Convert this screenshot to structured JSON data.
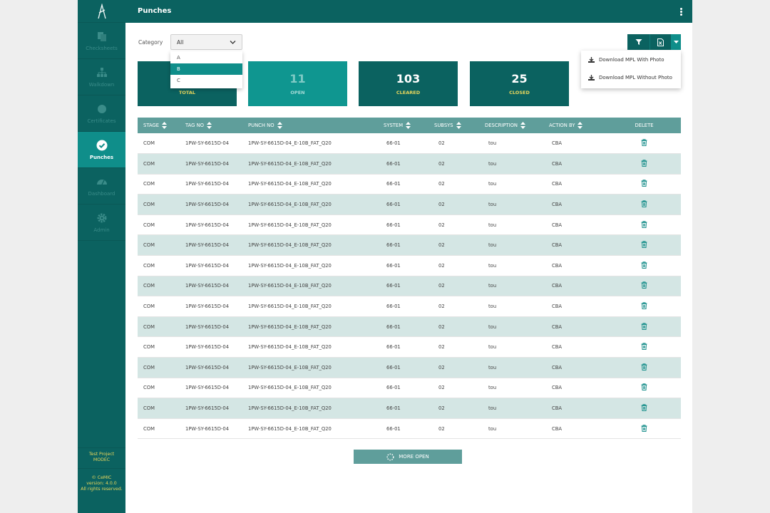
{
  "sidebar": {
    "items": [
      {
        "label": "Checksheets",
        "icon": "checksheets-icon"
      },
      {
        "label": "Walkdown",
        "icon": "hierarchy-icon"
      },
      {
        "label": "Certificates",
        "icon": "certificate-icon"
      },
      {
        "label": "Punches",
        "icon": "check-circle-icon",
        "active": true
      },
      {
        "label": "Dashboard",
        "icon": "gauge-icon"
      },
      {
        "label": "Admin",
        "icon": "gear-icon"
      }
    ],
    "project_line1": "Test Project",
    "project_line2": "MODEC",
    "footer_line1": "© CeMIC",
    "footer_line2": "version: 4.0.0",
    "footer_line3": "All rights reserved."
  },
  "header": {
    "title": "Punches"
  },
  "filter": {
    "label": "Category",
    "selected": "All",
    "options": [
      "A",
      "B",
      "C"
    ],
    "highlighted": "B"
  },
  "cards": [
    {
      "value": "",
      "label": "TOTAL"
    },
    {
      "value": "11",
      "label": "OPEN"
    },
    {
      "value": "103",
      "label": "CLEARED"
    },
    {
      "value": "25",
      "label": "CLOSED"
    }
  ],
  "export_menu": {
    "with_photo": "Download MPL With Photo",
    "without_photo": "Download MPL Without Photo"
  },
  "table": {
    "headers": {
      "stage": "STAGE",
      "tag_no": "TAG NO",
      "punch_no": "PUNCH NO",
      "system": "SYSTEM",
      "subsys": "SUBSYS",
      "description": "DESCRIPTION",
      "action_by": "ACTION BY",
      "delete": "DELETE"
    },
    "rows": [
      {
        "stage": "COM",
        "tag_no": "1PW-SY-6615D-04",
        "punch_no": "1PW-SY-6615D-04_E-10B_FAT_Q20",
        "system": "66-01",
        "subsys": "02",
        "description": "tou",
        "action_by": "CBA"
      },
      {
        "stage": "COM",
        "tag_no": "1PW-SY-6615D-04",
        "punch_no": "1PW-SY-6615D-04_E-10B_FAT_Q20",
        "system": "66-01",
        "subsys": "02",
        "description": "tou",
        "action_by": "CBA"
      },
      {
        "stage": "COM",
        "tag_no": "1PW-SY-6615D-04",
        "punch_no": "1PW-SY-6615D-04_E-10B_FAT_Q20",
        "system": "66-01",
        "subsys": "02",
        "description": "tou",
        "action_by": "CBA"
      },
      {
        "stage": "COM",
        "tag_no": "1PW-SY-6615D-04",
        "punch_no": "1PW-SY-6615D-04_E-10B_FAT_Q20",
        "system": "66-01",
        "subsys": "02",
        "description": "tou",
        "action_by": "CBA"
      },
      {
        "stage": "COM",
        "tag_no": "1PW-SY-6615D-04",
        "punch_no": "1PW-SY-6615D-04_E-10B_FAT_Q20",
        "system": "66-01",
        "subsys": "02",
        "description": "tou",
        "action_by": "CBA"
      },
      {
        "stage": "COM",
        "tag_no": "1PW-SY-6615D-04",
        "punch_no": "1PW-SY-6615D-04_E-10B_FAT_Q20",
        "system": "66-01",
        "subsys": "02",
        "description": "tou",
        "action_by": "CBA"
      },
      {
        "stage": "COM",
        "tag_no": "1PW-SY-6615D-04",
        "punch_no": "1PW-SY-6615D-04_E-10B_FAT_Q20",
        "system": "66-01",
        "subsys": "02",
        "description": "tou",
        "action_by": "CBA"
      },
      {
        "stage": "COM",
        "tag_no": "1PW-SY-6615D-04",
        "punch_no": "1PW-SY-6615D-04_E-10B_FAT_Q20",
        "system": "66-01",
        "subsys": "02",
        "description": "tou",
        "action_by": "CBA"
      },
      {
        "stage": "COM",
        "tag_no": "1PW-SY-6615D-04",
        "punch_no": "1PW-SY-6615D-04_E-10B_FAT_Q20",
        "system": "66-01",
        "subsys": "02",
        "description": "tou",
        "action_by": "CBA"
      },
      {
        "stage": "COM",
        "tag_no": "1PW-SY-6615D-04",
        "punch_no": "1PW-SY-6615D-04_E-10B_FAT_Q20",
        "system": "66-01",
        "subsys": "02",
        "description": "tou",
        "action_by": "CBA"
      },
      {
        "stage": "COM",
        "tag_no": "1PW-SY-6615D-04",
        "punch_no": "1PW-SY-6615D-04_E-10B_FAT_Q20",
        "system": "66-01",
        "subsys": "02",
        "description": "tou",
        "action_by": "CBA"
      },
      {
        "stage": "COM",
        "tag_no": "1PW-SY-6615D-04",
        "punch_no": "1PW-SY-6615D-04_E-10B_FAT_Q20",
        "system": "66-01",
        "subsys": "02",
        "description": "tou",
        "action_by": "CBA"
      },
      {
        "stage": "COM",
        "tag_no": "1PW-SY-6615D-04",
        "punch_no": "1PW-SY-6615D-04_E-10B_FAT_Q20",
        "system": "66-01",
        "subsys": "02",
        "description": "tou",
        "action_by": "CBA"
      },
      {
        "stage": "COM",
        "tag_no": "1PW-SY-6615D-04",
        "punch_no": "1PW-SY-6615D-04_E-10B_FAT_Q20",
        "system": "66-01",
        "subsys": "02",
        "description": "tou",
        "action_by": "CBA"
      },
      {
        "stage": "COM",
        "tag_no": "1PW-SY-6615D-04",
        "punch_no": "1PW-SY-6615D-04_E-10B_FAT_Q20",
        "system": "66-01",
        "subsys": "02",
        "description": "tou",
        "action_by": "CBA"
      }
    ]
  },
  "more_button": {
    "label": "MORE OPEN"
  }
}
